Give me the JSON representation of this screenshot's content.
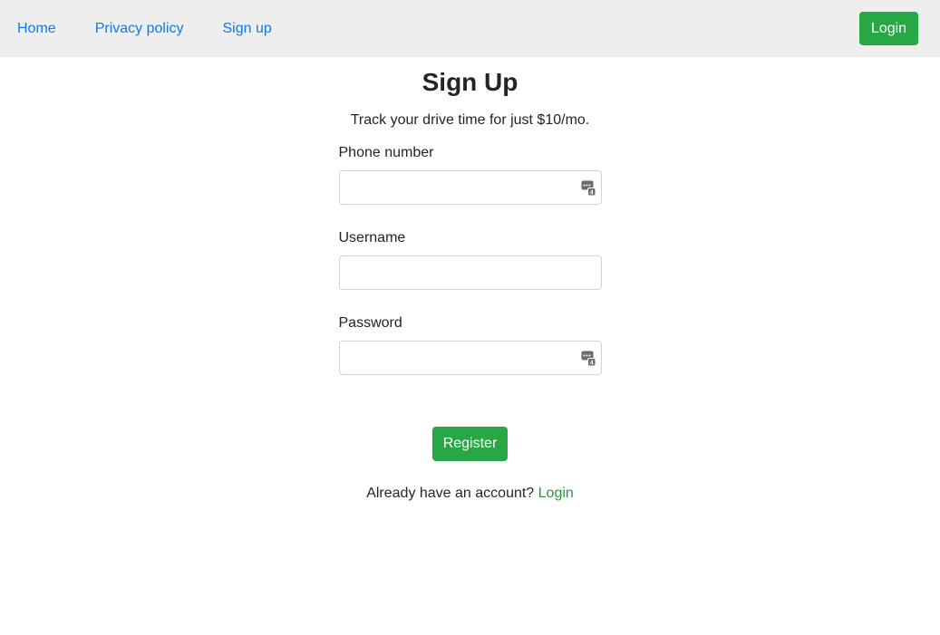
{
  "nav": {
    "links": [
      "Home",
      "Privacy policy",
      "Sign up"
    ],
    "login_label": "Login"
  },
  "page": {
    "title": "Sign Up",
    "subtitle": "Track your drive time for just $10/mo."
  },
  "form": {
    "phone": {
      "label": "Phone number",
      "value": "",
      "icon": "password-manager-icon"
    },
    "username": {
      "label": "Username",
      "value": ""
    },
    "password": {
      "label": "Password",
      "value": "",
      "icon": "password-manager-icon"
    },
    "submit_label": "Register"
  },
  "footer": {
    "prompt": "Already have an account?",
    "login_link": "Login"
  },
  "colors": {
    "nav_background": "#eeeeee",
    "link_blue": "#0d7bf0",
    "button_green": "#28a745",
    "login_link_green": "#27973e"
  }
}
